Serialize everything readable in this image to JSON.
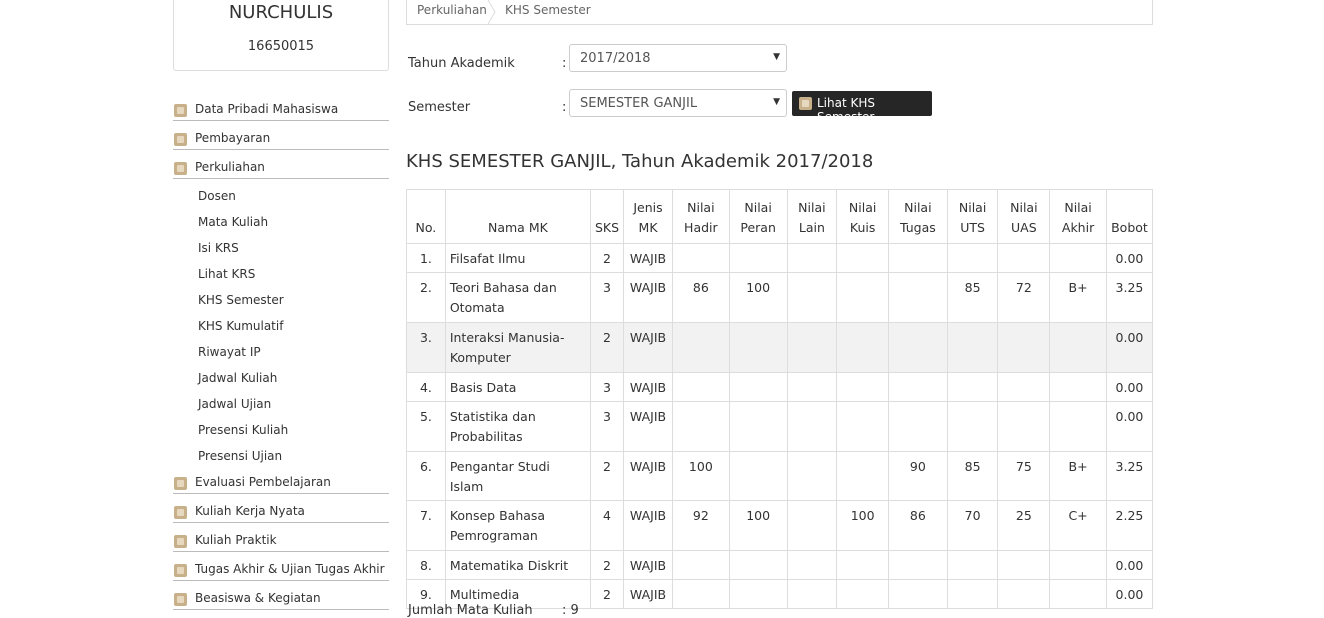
{
  "profile": {
    "name": "NURCHULIS",
    "nim": "16650015"
  },
  "menu": {
    "top": [
      "Data Pribadi Mahasiswa",
      "Pembayaran",
      "Perkuliahan"
    ],
    "sub": [
      "Dosen",
      "Mata Kuliah",
      "Isi KRS",
      "Lihat KRS",
      "KHS Semester",
      "KHS Kumulatif",
      "Riwayat IP",
      "Jadwal Kuliah",
      "Jadwal Ujian",
      "Presensi Kuliah",
      "Presensi Ujian"
    ],
    "bottom": [
      "Evaluasi Pembelajaran",
      "Kuliah Kerja Nyata",
      "Kuliah Praktik",
      "Tugas Akhir & Ujian Tugas Akhir",
      "Beasiswa & Kegiatan"
    ]
  },
  "breadcrumb": {
    "parent": "Perkuliahan",
    "current": "KHS Semester"
  },
  "form": {
    "tahun_label": "Tahun Akademik",
    "tahun_value": "2017/2018",
    "semester_label": "Semester",
    "semester_value": "SEMESTER GANJIL",
    "colon": ":",
    "button_label": "Lihat KHS Semester"
  },
  "heading": "KHS SEMESTER GANJIL, Tahun Akademik 2017/2018",
  "table": {
    "headers": [
      "No.",
      "Nama MK",
      "SKS",
      "Jenis MK",
      "Nilai Hadir",
      "Nilai Peran",
      "Nilai Lain",
      "Nilai Kuis",
      "Nilai Tugas",
      "Nilai UTS",
      "Nilai UAS",
      "Nilai Akhir",
      "Bobot"
    ],
    "rows": [
      {
        "no": "1.",
        "nama": "Filsafat Ilmu",
        "sks": "2",
        "jenis": "WAJIB",
        "hadir": "",
        "peran": "",
        "lain": "",
        "kuis": "",
        "tugas": "",
        "uts": "",
        "uas": "",
        "akhir": "",
        "bobot": "0.00"
      },
      {
        "no": "2.",
        "nama": "Teori Bahasa dan Otomata",
        "sks": "3",
        "jenis": "WAJIB",
        "hadir": "86",
        "peran": "100",
        "lain": "",
        "kuis": "",
        "tugas": "",
        "uts": "85",
        "uas": "72",
        "akhir": "B+",
        "bobot": "3.25"
      },
      {
        "no": "3.",
        "nama": "Interaksi Manusia-Komputer",
        "sks": "2",
        "jenis": "WAJIB",
        "hadir": "",
        "peran": "",
        "lain": "",
        "kuis": "",
        "tugas": "",
        "uts": "",
        "uas": "",
        "akhir": "",
        "bobot": "0.00"
      },
      {
        "no": "4.",
        "nama": "Basis Data",
        "sks": "3",
        "jenis": "WAJIB",
        "hadir": "",
        "peran": "",
        "lain": "",
        "kuis": "",
        "tugas": "",
        "uts": "",
        "uas": "",
        "akhir": "",
        "bobot": "0.00"
      },
      {
        "no": "5.",
        "nama": "Statistika dan Probabilitas",
        "sks": "3",
        "jenis": "WAJIB",
        "hadir": "",
        "peran": "",
        "lain": "",
        "kuis": "",
        "tugas": "",
        "uts": "",
        "uas": "",
        "akhir": "",
        "bobot": "0.00"
      },
      {
        "no": "6.",
        "nama": "Pengantar Studi Islam",
        "sks": "2",
        "jenis": "WAJIB",
        "hadir": "100",
        "peran": "",
        "lain": "",
        "kuis": "",
        "tugas": "90",
        "uts": "85",
        "uas": "75",
        "akhir": "B+",
        "bobot": "3.25"
      },
      {
        "no": "7.",
        "nama": "Konsep Bahasa Pemrograman",
        "sks": "4",
        "jenis": "WAJIB",
        "hadir": "92",
        "peran": "100",
        "lain": "",
        "kuis": "100",
        "tugas": "86",
        "uts": "70",
        "uas": "25",
        "akhir": "C+",
        "bobot": "2.25"
      },
      {
        "no": "8.",
        "nama": "Matematika Diskrit",
        "sks": "2",
        "jenis": "WAJIB",
        "hadir": "",
        "peran": "",
        "lain": "",
        "kuis": "",
        "tugas": "",
        "uts": "",
        "uas": "",
        "akhir": "",
        "bobot": "0.00"
      },
      {
        "no": "9.",
        "nama": "Multimedia",
        "sks": "2",
        "jenis": "WAJIB",
        "hadir": "",
        "peran": "",
        "lain": "",
        "kuis": "",
        "tugas": "",
        "uts": "",
        "uas": "",
        "akhir": "",
        "bobot": "0.00"
      }
    ]
  },
  "summary": {
    "label": "Jumlah Mata Kuliah",
    "value": ": 9"
  }
}
